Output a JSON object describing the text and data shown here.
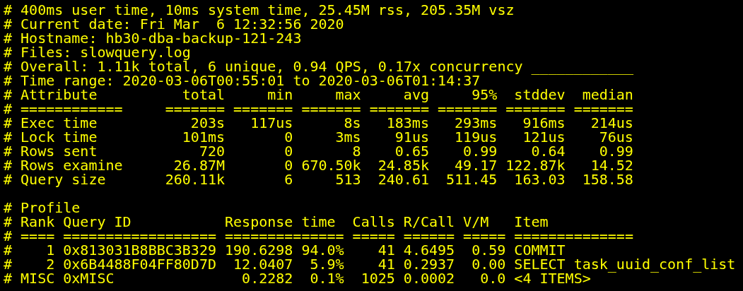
{
  "terminal": {
    "header_lines": [
      "# 400ms user time, 10ms system time, 25.45M rss, 205.35M vsz",
      "# Current date: Fri Mar  6 12:32:56 2020",
      "# Hostname: hb30-dba-backup-121-243",
      "# Files: slowquery.log",
      "# Overall: 1.11k total, 6 unique, 0.94 QPS, 0.17x concurrency ____________",
      "# Time range: 2020-03-06T00:55:01 to 2020-03-06T01:14:37"
    ],
    "attribute_table": [
      [
        "#",
        "Attribute",
        "total",
        "min",
        "max",
        "avg",
        "95%",
        "stddev",
        "median"
      ],
      [
        "#",
        "============",
        "=======",
        "=======",
        "=======",
        "=======",
        "=======",
        "=======",
        "======="
      ],
      [
        "#",
        "Exec time",
        "203s",
        "117us",
        "8s",
        "183ms",
        "293ms",
        "916ms",
        "214us"
      ],
      [
        "#",
        "Lock time",
        "101ms",
        "0",
        "3ms",
        "91us",
        "119us",
        "121us",
        "76us"
      ],
      [
        "#",
        "Rows sent",
        "720",
        "0",
        "8",
        "0.65",
        "0.99",
        "0.64",
        "0.99"
      ],
      [
        "#",
        "Rows examine",
        "26.87M",
        "0",
        "670.50k",
        "24.85k",
        "49.17",
        "122.87k",
        "14.52"
      ],
      [
        "#",
        "Query size",
        "260.11k",
        "6",
        "513",
        "240.61",
        "511.45",
        "163.03",
        "158.58"
      ]
    ],
    "profile_title": "# Profile",
    "profile_table": [
      {
        "kind": "header",
        "cells": [
          "#",
          "Rank",
          "Query ID",
          "Response time",
          "Calls",
          "R/Call",
          "V/M",
          "Item"
        ]
      },
      {
        "kind": "rule",
        "cells": [
          "#",
          "====",
          "==================",
          "==============",
          "=====",
          "======",
          "=====",
          "=============="
        ]
      },
      {
        "kind": "data",
        "cells": [
          "#",
          "1",
          "0x813031B8BBC3B329",
          "190.6298",
          "94.0%",
          "41",
          "4.6495",
          "0.59",
          "COMMIT"
        ]
      },
      {
        "kind": "data",
        "cells": [
          "#",
          "2",
          "0x6B4488F04FF80D7D",
          "12.0407",
          "5.9%",
          "41",
          "0.2937",
          "0.00",
          "SELECT task_uuid_conf_list"
        ]
      },
      {
        "kind": "data",
        "cells": [
          "#",
          "MISC",
          "0xMISC",
          "0.2282",
          "0.1%",
          "1025",
          "0.0002",
          "0.0",
          "<4 ITEMS>"
        ]
      }
    ]
  }
}
